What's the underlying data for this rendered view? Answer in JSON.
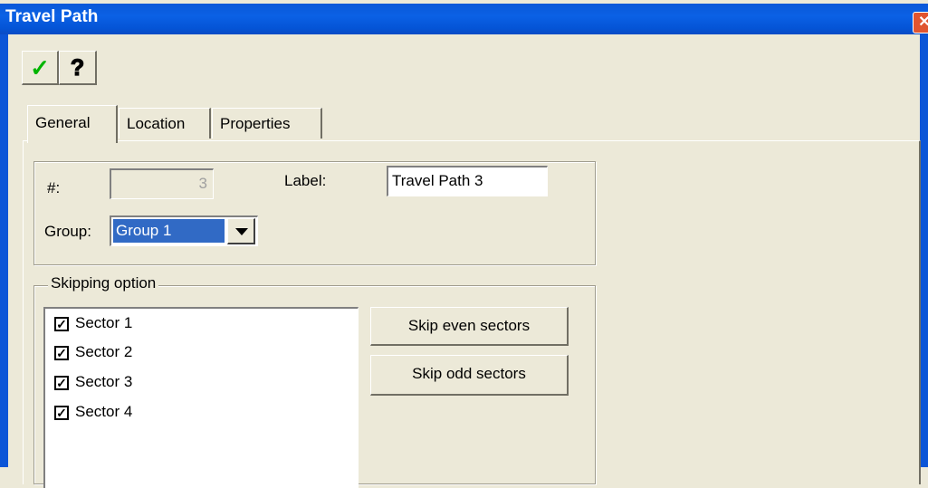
{
  "window": {
    "title": "Travel Path",
    "close_glyph": "✕"
  },
  "toolbar": {
    "ok_icon": "checkmark-icon",
    "ok_glyph": "✓",
    "help_icon": "help-question-icon",
    "help_glyph": "?"
  },
  "tabs": [
    {
      "label": "General",
      "active": true
    },
    {
      "label": "Location",
      "active": false
    },
    {
      "label": "Properties",
      "active": false
    }
  ],
  "general": {
    "number_label": "#:",
    "number_value": "3",
    "label_label": "Label:",
    "label_value": "Travel Path 3",
    "group_label": "Group:",
    "group_value": "Group 1"
  },
  "skipping": {
    "legend": "Skipping option",
    "sectors": [
      {
        "label": "Sector 1",
        "checked": true
      },
      {
        "label": "Sector 2",
        "checked": true
      },
      {
        "label": "Sector 3",
        "checked": true
      },
      {
        "label": "Sector 4",
        "checked": true
      }
    ],
    "skip_even_label": "Skip even sectors",
    "skip_odd_label": "Skip odd sectors",
    "check_glyph": "✓"
  },
  "colors": {
    "titlebar": "#0B61E5",
    "face": "#ECE9D8",
    "selection": "#316AC5",
    "close": "#E0542F"
  }
}
